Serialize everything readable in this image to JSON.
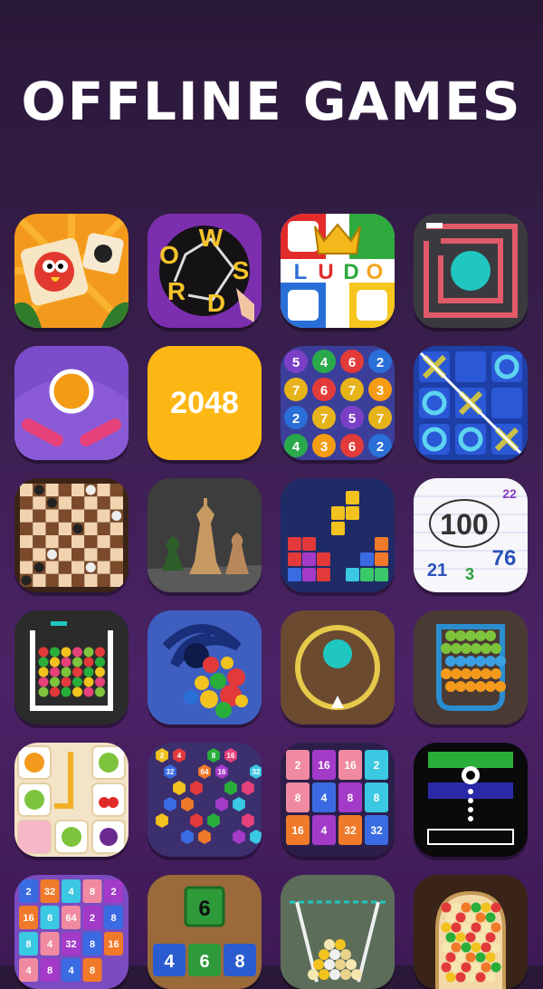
{
  "header": {
    "title": "OFFLINE GAMES"
  },
  "apps": [
    {
      "icon": "tile-match-icon"
    },
    {
      "icon": "word-search-icon",
      "letters": [
        "W",
        "O",
        "R",
        "D",
        "S"
      ]
    },
    {
      "icon": "ludo-icon",
      "text": [
        "L",
        "U",
        "D",
        "O"
      ]
    },
    {
      "icon": "maze-ball-icon"
    },
    {
      "icon": "pinball-icon"
    },
    {
      "icon": "2048-icon",
      "text": "2048"
    },
    {
      "icon": "number-balls-icon",
      "numbers": [
        "5",
        "4",
        "6",
        "2",
        "7",
        "6",
        "7",
        "3",
        "2",
        "7",
        "5",
        "7",
        "4",
        "3",
        "6",
        "2"
      ]
    },
    {
      "icon": "tic-tac-toe-icon"
    },
    {
      "icon": "checkers-icon"
    },
    {
      "icon": "chess-icon"
    },
    {
      "icon": "block-puzzle-icon"
    },
    {
      "icon": "number-hunt-icon",
      "numbers": [
        "100",
        "22",
        "21",
        "3",
        "76"
      ]
    },
    {
      "icon": "ball-drop-icon"
    },
    {
      "icon": "black-hole-icon"
    },
    {
      "icon": "circle-ball-icon"
    },
    {
      "icon": "ball-cup-icon"
    },
    {
      "icon": "fruit-connect-icon"
    },
    {
      "icon": "hexa-number-icon",
      "numbers": [
        "2",
        "4",
        "8",
        "16",
        "32",
        "64",
        "16",
        "32"
      ]
    },
    {
      "icon": "merge-blocks-icon",
      "numbers": [
        "2",
        "16",
        "16",
        "2",
        "8",
        "4",
        "8",
        "8",
        "16",
        "4",
        "32",
        "32"
      ]
    },
    {
      "icon": "color-switch-icon"
    },
    {
      "icon": "number-grid-icon",
      "numbers": [
        "2",
        "32",
        "4",
        "8",
        "2",
        "16",
        "8",
        "64",
        "2",
        "8",
        "8",
        "4",
        "32",
        "8",
        "16",
        "4",
        "8",
        "4",
        "8"
      ]
    },
    {
      "icon": "wood-number-icon",
      "numbers": [
        "6",
        "4",
        "6",
        "8"
      ]
    },
    {
      "icon": "balls-bucket-icon"
    },
    {
      "icon": "plinko-balls-icon"
    }
  ]
}
